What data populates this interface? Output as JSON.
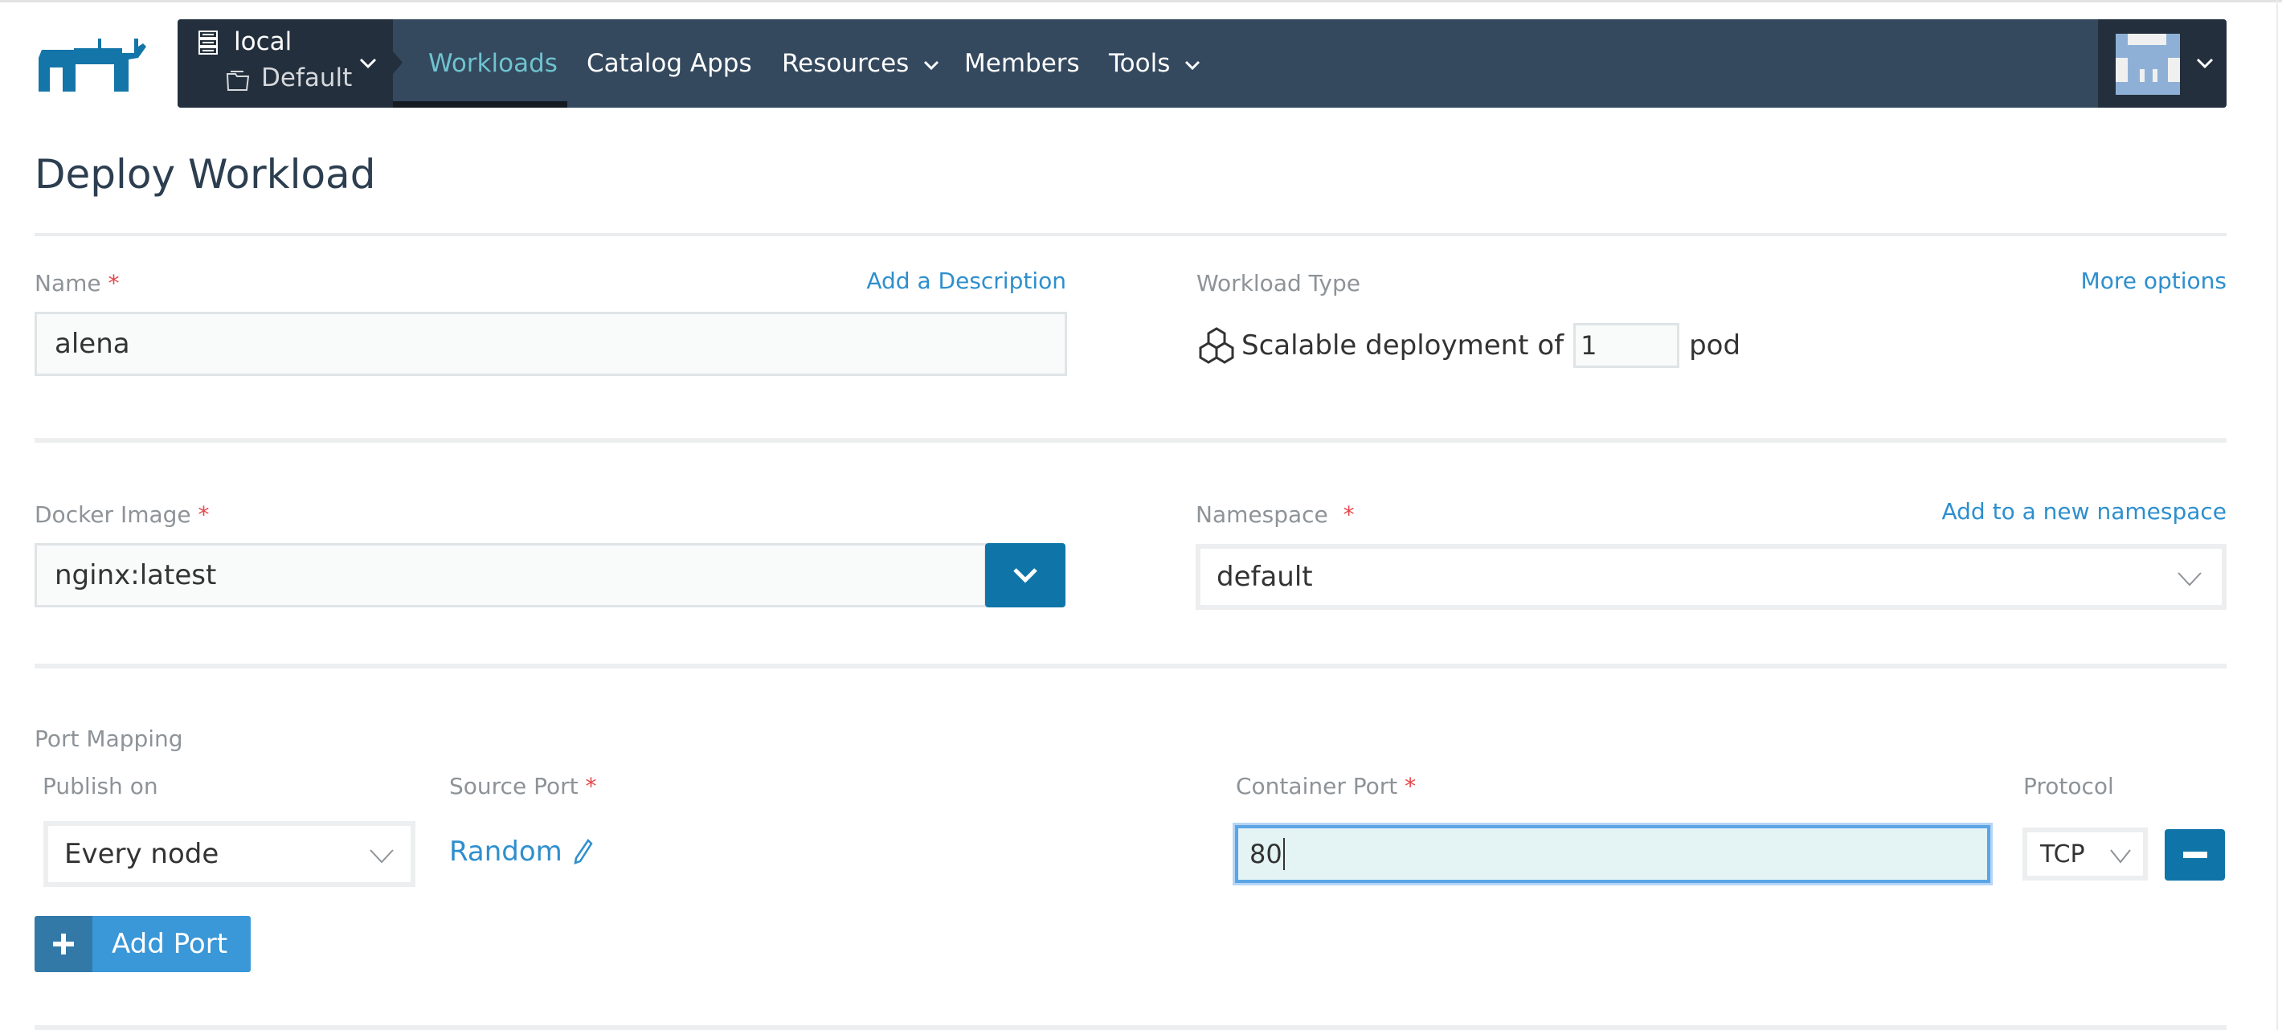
{
  "navbar": {
    "cluster_name": "local",
    "project_name": "Default",
    "items": [
      {
        "label": "Workloads",
        "active": true,
        "has_dropdown": false
      },
      {
        "label": "Catalog Apps",
        "active": false,
        "has_dropdown": false
      },
      {
        "label": "Resources",
        "active": false,
        "has_dropdown": true
      },
      {
        "label": "Members",
        "active": false,
        "has_dropdown": false
      },
      {
        "label": "Tools",
        "active": false,
        "has_dropdown": true
      }
    ],
    "chevron": "⌄"
  },
  "page": {
    "title": "Deploy Workload"
  },
  "form": {
    "name": {
      "label": "Name",
      "required_mark": "*",
      "value": "alena",
      "link": "Add a Description"
    },
    "workload_type": {
      "label": "Workload Type",
      "link": "More options",
      "prefix": "Scalable deployment of",
      "count": "1",
      "suffix": "pod"
    },
    "docker_image": {
      "label": "Docker Image",
      "required_mark": "*",
      "value": "nginx:latest"
    },
    "namespace": {
      "label": "Namespace",
      "required_mark": "*",
      "value": "default",
      "link": "Add to a new namespace"
    },
    "port_mapping": {
      "label": "Port Mapping",
      "columns": {
        "publish_on": "Publish on",
        "source_port": "Source Port",
        "container_port": "Container Port",
        "protocol": "Protocol"
      },
      "required_mark": "*",
      "row": {
        "publish_on": "Every node",
        "source_port": "Random",
        "container_port": "80",
        "protocol": "TCP"
      },
      "add_button": "Add Port"
    }
  },
  "colors": {
    "accent": "#0f75a8",
    "nav_bg": "#34495e",
    "nav_dark": "#232f3c",
    "active_nav": "#6fc3cf",
    "link": "#2e8fcd",
    "required": "#e8464a"
  }
}
